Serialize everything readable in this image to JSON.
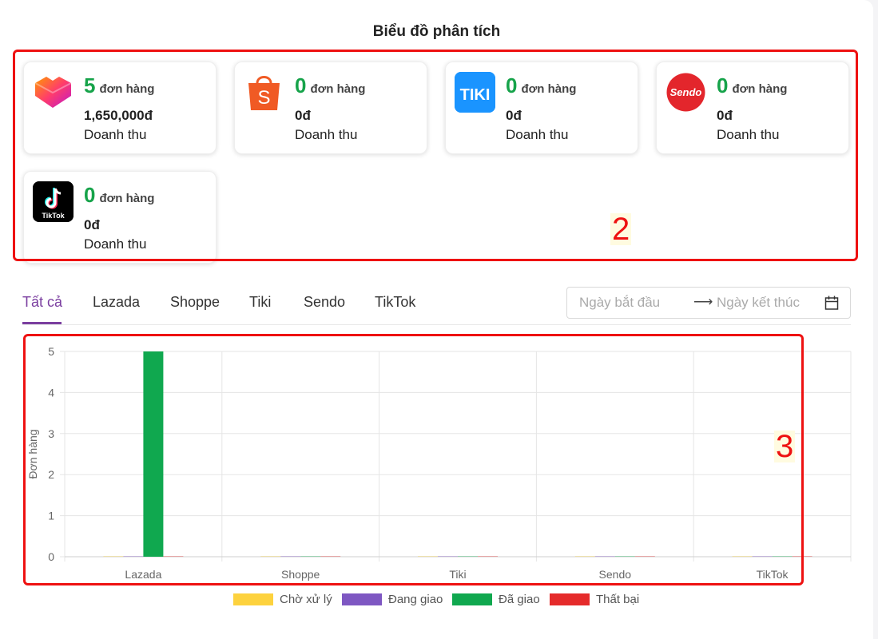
{
  "page": {
    "title": "Biểu đồ phân tích"
  },
  "cards": [
    {
      "name": "lazada",
      "count": "5",
      "unit": "đơn hàng",
      "amount": "1,650,000đ",
      "revenue_label": "Doanh thu"
    },
    {
      "name": "shoppe",
      "count": "0",
      "unit": "đơn hàng",
      "amount": "0đ",
      "revenue_label": "Doanh thu"
    },
    {
      "name": "tiki",
      "count": "0",
      "unit": "đơn hàng",
      "amount": "0đ",
      "revenue_label": "Doanh thu",
      "logo_text": "TIKI"
    },
    {
      "name": "sendo",
      "count": "0",
      "unit": "đơn hàng",
      "amount": "0đ",
      "revenue_label": "Doanh thu",
      "logo_text": "Sendo"
    },
    {
      "name": "tiktok",
      "count": "0",
      "unit": "đơn hàng",
      "amount": "0đ",
      "revenue_label": "Doanh thu",
      "logo_text": "TikTok"
    }
  ],
  "annotations": {
    "cards_label": "2",
    "chart_label": "3"
  },
  "tabs": [
    "Tất cả",
    "Lazada",
    "Shoppe",
    "Tiki",
    "Sendo",
    "TikTok"
  ],
  "active_tab": "Tất cả",
  "date_range": {
    "start_placeholder": "Ngày bắt đầu",
    "end_placeholder": "Ngày kết thúc"
  },
  "colors": {
    "accent": "#7b3fa0",
    "count_green": "#16a34a",
    "annotation_red": "#e11111"
  },
  "chart_data": {
    "type": "bar",
    "categories": [
      "Lazada",
      "Shoppe",
      "Tiki",
      "Sendo",
      "TikTok"
    ],
    "ylabel": "Đơn hàng",
    "xlabel": "",
    "ylim": [
      0,
      5
    ],
    "yticks": [
      "0",
      "1",
      "2",
      "3",
      "4",
      "5"
    ],
    "grid": true,
    "legend_position": "bottom",
    "series": [
      {
        "name": "Chờ xử lý",
        "color": "#fdd23e",
        "values": [
          0,
          0,
          0,
          0,
          0
        ]
      },
      {
        "name": "Đang giao",
        "color": "#7e57c2",
        "values": [
          0,
          0,
          0,
          0,
          0
        ]
      },
      {
        "name": "Đã giao",
        "color": "#10a84f",
        "values": [
          5,
          0,
          0,
          0,
          0
        ]
      },
      {
        "name": "Thất bại",
        "color": "#e52b2b",
        "values": [
          0,
          0,
          0,
          0,
          0
        ]
      }
    ]
  }
}
